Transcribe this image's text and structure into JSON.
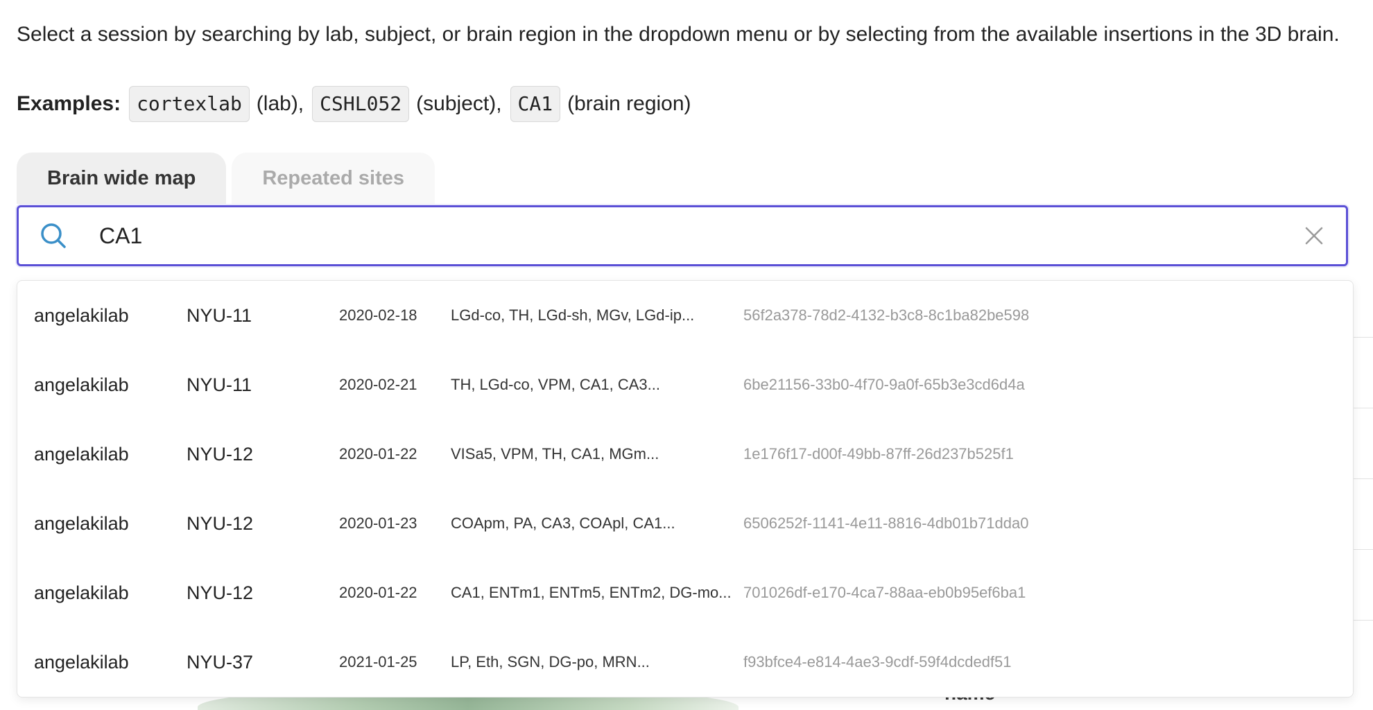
{
  "intro": {
    "text": "Select a session by searching by lab, subject, or brain region in the dropdown menu or by selecting from the available insertions in the 3D brain."
  },
  "examples": {
    "label": "Examples:",
    "items": [
      {
        "code": "cortexlab",
        "suffix": "(lab),"
      },
      {
        "code": "CSHL052",
        "suffix": "(subject),"
      },
      {
        "code": "CA1",
        "suffix": "(brain region)"
      }
    ]
  },
  "tabs": [
    {
      "label": "Brain wide map",
      "active": true
    },
    {
      "label": "Repeated sites",
      "active": false
    }
  ],
  "search": {
    "value": "CA1",
    "icon": "search-icon",
    "clear_icon": "close-icon",
    "accent_color": "#5a4fd6"
  },
  "background": {
    "partial_label": "name"
  },
  "results": [
    {
      "lab": "angelakilab",
      "subject": "NYU-11",
      "date": "2020-02-18",
      "regions": "LGd-co, TH, LGd-sh, MGv, LGd-ip...",
      "eid": "56f2a378-78d2-4132-b3c8-8c1ba82be598"
    },
    {
      "lab": "angelakilab",
      "subject": "NYU-11",
      "date": "2020-02-21",
      "regions": "TH, LGd-co, VPM, CA1, CA3...",
      "eid": "6be21156-33b0-4f70-9a0f-65b3e3cd6d4a"
    },
    {
      "lab": "angelakilab",
      "subject": "NYU-12",
      "date": "2020-01-22",
      "regions": "VISa5, VPM, TH, CA1, MGm...",
      "eid": "1e176f17-d00f-49bb-87ff-26d237b525f1"
    },
    {
      "lab": "angelakilab",
      "subject": "NYU-12",
      "date": "2020-01-23",
      "regions": "COApm, PA, CA3, COApl, CA1...",
      "eid": "6506252f-1141-4e11-8816-4db01b71dda0"
    },
    {
      "lab": "angelakilab",
      "subject": "NYU-12",
      "date": "2020-01-22",
      "regions": "CA1, ENTm1, ENTm5, ENTm2, DG-mo...",
      "eid": "701026df-e170-4ca7-88aa-eb0b95ef6ba1"
    },
    {
      "lab": "angelakilab",
      "subject": "NYU-37",
      "date": "2021-01-25",
      "regions": "LP, Eth, SGN, DG-po, MRN...",
      "eid": "f93bfce4-e814-4ae3-9cdf-59f4dcdedf51"
    }
  ]
}
